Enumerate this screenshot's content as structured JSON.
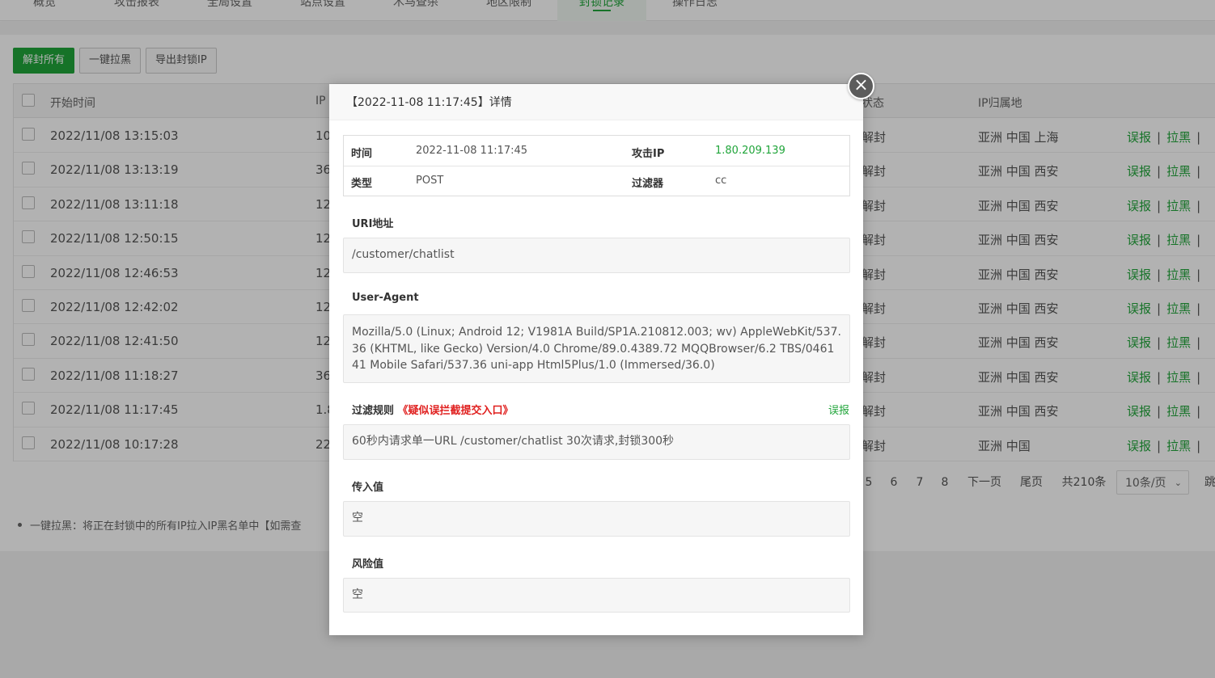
{
  "nav": {
    "tabs": [
      "概览",
      "攻击报表",
      "全局设置",
      "站点设置",
      "木马查杀",
      "地区限制",
      "封锁记录",
      "操作日志"
    ],
    "active_tab": "封锁记录"
  },
  "toolbar": {
    "unblock_all": "解封所有",
    "one_click_blacklist": "一键拉黑",
    "export_ip": "导出封锁IP"
  },
  "table": {
    "headers": {
      "start_time": "开始时间",
      "ip": "IP",
      "status": "状态",
      "region": "IP归属地"
    },
    "rows": [
      {
        "time": "2022/11/08 13:15:03",
        "ip": "10",
        "status": "解封",
        "region": "亚洲 中国 上海",
        "action1": "误报",
        "action2": "拉黑",
        "sep": "|"
      },
      {
        "time": "2022/11/08 13:13:19",
        "ip": "36",
        "status": "解封",
        "region": "亚洲 中国 西安",
        "action1": "误报",
        "action2": "拉黑",
        "sep": "|"
      },
      {
        "time": "2022/11/08 13:11:18",
        "ip": "12",
        "status": "解封",
        "region": "亚洲 中国 西安",
        "action1": "误报",
        "action2": "拉黑",
        "sep": "|"
      },
      {
        "time": "2022/11/08 12:50:15",
        "ip": "12",
        "status": "解封",
        "region": "亚洲 中国 西安",
        "action1": "误报",
        "action2": "拉黑",
        "sep": "|"
      },
      {
        "time": "2022/11/08 12:46:53",
        "ip": "12",
        "status": "解封",
        "region": "亚洲 中国 西安",
        "action1": "误报",
        "action2": "拉黑",
        "sep": "|"
      },
      {
        "time": "2022/11/08 12:42:02",
        "ip": "12",
        "status": "解封",
        "region": "亚洲 中国 西安",
        "action1": "误报",
        "action2": "拉黑",
        "sep": "|"
      },
      {
        "time": "2022/11/08 12:41:50",
        "ip": "12",
        "status": "解封",
        "region": "亚洲 中国 西安",
        "action1": "误报",
        "action2": "拉黑",
        "sep": "|"
      },
      {
        "time": "2022/11/08 11:18:27",
        "ip": "36",
        "status": "解封",
        "region": "亚洲 中国 西安",
        "action1": "误报",
        "action2": "拉黑",
        "sep": "|"
      },
      {
        "time": "2022/11/08 11:17:45",
        "ip": "1.8",
        "status": "解封",
        "region": "亚洲 中国 西安",
        "action1": "误报",
        "action2": "拉黑",
        "sep": "|"
      },
      {
        "time": "2022/11/08 10:17:28",
        "ip": "22",
        "status": "解封",
        "region": "亚洲 中国",
        "action1": "误报",
        "action2": "拉黑",
        "sep": "|"
      }
    ]
  },
  "pagination": {
    "pages": [
      "5",
      "6",
      "7",
      "8"
    ],
    "next": "下一页",
    "last": "尾页",
    "total": "共210条",
    "per_page": "10条/页",
    "jump": "跳"
  },
  "tip": "一键拉黑：将正在封锁中的所有IP拉入IP黑名单中【如需查",
  "modal": {
    "title": "【2022-11-08 11:17:45】详情",
    "close_glyph": "×",
    "info": {
      "time_label": "时间",
      "time_value": "2022-11-08 11:17:45",
      "ip_label": "攻击IP",
      "ip_value": "1.80.209.139",
      "type_label": "类型",
      "type_value": "POST",
      "filter_label": "过滤器",
      "filter_value": "cc"
    },
    "uri_label": "URI地址",
    "uri_value": "/customer/chatlist",
    "ua_label": "User-Agent",
    "ua_value": "Mozilla/5.0 (Linux; Android 12; V1981A Build/SP1A.210812.003; wv) AppleWebKit/537.36 (KHTML, like Gecko) Version/4.0 Chrome/89.0.4389.72 MQQBrowser/6.2 TBS/046141 Mobile Safari/537.36 uni-app Html5Plus/1.0 (Immersed/36.0)",
    "rule_label": "过滤规则",
    "rule_link": "《疑似误拦截提交入口》",
    "report_label": "误报",
    "rule_value": "60秒内请求单一URL /customer/chatlist 30次请求,封锁300秒",
    "input_label": "传入值",
    "input_value": "空",
    "risk_label": "风险值",
    "risk_value": "空"
  }
}
